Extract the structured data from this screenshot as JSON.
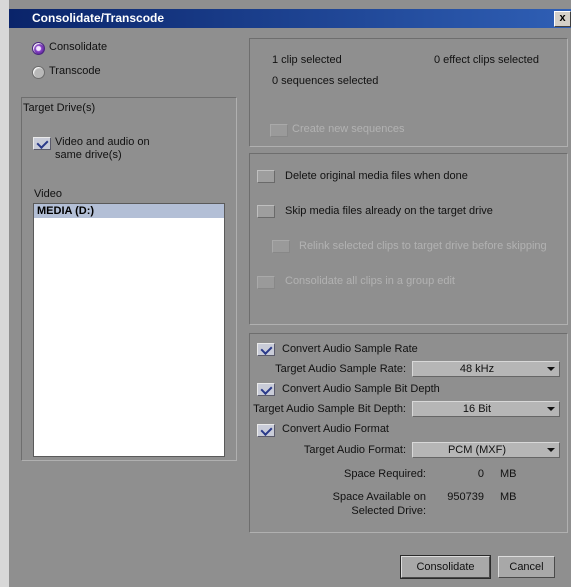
{
  "window": {
    "title": "Consolidate/Transcode",
    "close_glyph": "x"
  },
  "mode": {
    "options": [
      {
        "label": "Consolidate",
        "selected": true
      },
      {
        "label": "Transcode",
        "selected": false
      }
    ]
  },
  "target_drives": {
    "title": "Target Drive(s)",
    "same_drive": {
      "label_line1": "Video and audio on",
      "label_line2": "same drive(s)",
      "checked": true
    },
    "video_label": "Video",
    "drives": [
      "MEDIA (D:)"
    ]
  },
  "selection_info": {
    "clips_selected": "1 clip selected",
    "effect_clips_selected": "0 effect clips selected",
    "sequences_selected": "0 sequences selected",
    "create_new_sequences": {
      "label": "Create new sequences",
      "checked": false,
      "enabled": false
    }
  },
  "options": {
    "delete_original": {
      "label": "Delete original media files when done",
      "checked": false
    },
    "skip_media": {
      "label": "Skip media files already on the target drive",
      "checked": false
    },
    "relink": {
      "label": "Relink selected clips to target drive before skipping",
      "checked": false,
      "enabled": false
    },
    "consolidate_group": {
      "label": "Consolidate all clips in a group edit",
      "checked": false,
      "enabled": false
    }
  },
  "audio": {
    "convert_rate": {
      "label": "Convert Audio Sample Rate",
      "checked": true
    },
    "rate_label": "Target Audio Sample Rate:",
    "rate_value": "48 kHz",
    "convert_depth": {
      "label": "Convert Audio Sample Bit Depth",
      "checked": true
    },
    "depth_label": "Target Audio Sample Bit Depth:",
    "depth_value": "16 Bit",
    "convert_format": {
      "label": "Convert Audio Format",
      "checked": true
    },
    "format_label": "Target Audio Format:",
    "format_value": "PCM  (MXF)",
    "space_required_label": "Space Required:",
    "space_required_value": "0",
    "space_required_unit": "MB",
    "space_available_label1": "Space Available on",
    "space_available_label2": "Selected Drive:",
    "space_available_value": "950739",
    "space_available_unit": "MB"
  },
  "buttons": {
    "consolidate": "Consolidate",
    "cancel": "Cancel"
  }
}
